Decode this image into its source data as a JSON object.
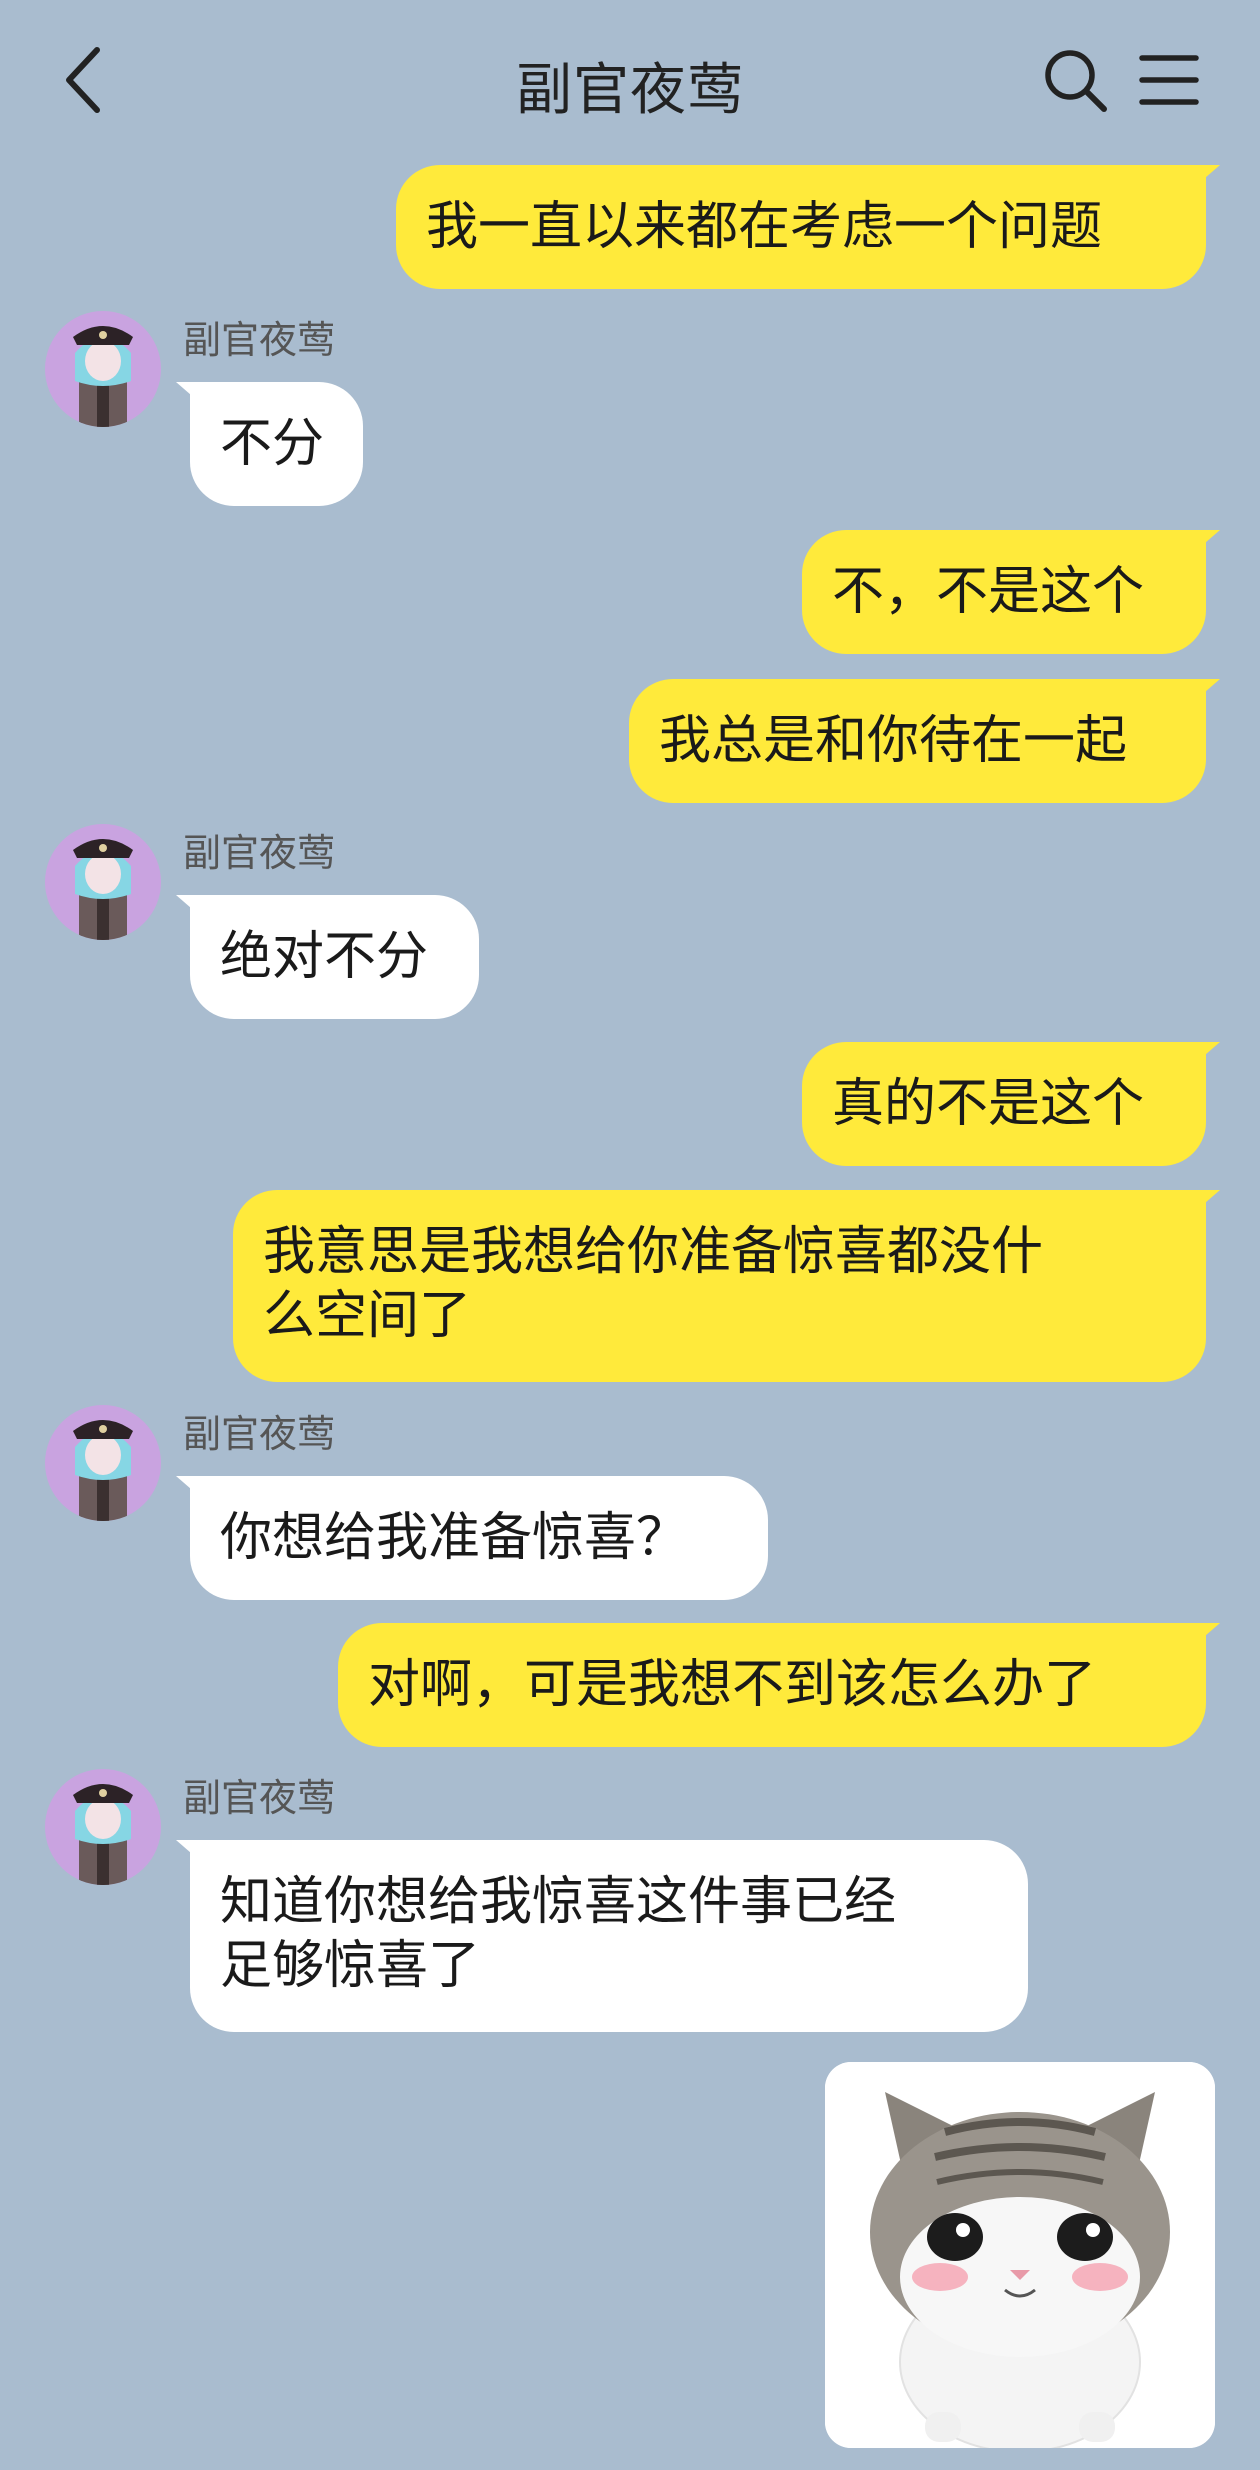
{
  "header": {
    "title": "副官夜莺",
    "back_icon": "chevron-left-icon",
    "search_icon": "search-icon",
    "menu_icon": "menu-icon"
  },
  "colors": {
    "background": "#a9bccf",
    "my_bubble": "#ffea3b",
    "their_bubble": "#ffffff",
    "avatar_bg": "#c9a3e0"
  },
  "messages": [
    {
      "from": "me",
      "text": "我一直以来都在考虑一个问题"
    },
    {
      "from": "them",
      "sender": "副官夜莺",
      "text": "不分"
    },
    {
      "from": "me",
      "text": "不，不是这个"
    },
    {
      "from": "me",
      "text": "我总是和你待在一起"
    },
    {
      "from": "them",
      "sender": "副官夜莺",
      "text": "绝对不分"
    },
    {
      "from": "me",
      "text": "真的不是这个"
    },
    {
      "from": "me",
      "text": "我意思是我想给你准备惊喜都没什\n么空间了"
    },
    {
      "from": "them",
      "sender": "副官夜莺",
      "text": "你想给我准备惊喜？"
    },
    {
      "from": "me",
      "text": "对啊，可是我想不到该怎么办了"
    },
    {
      "from": "them",
      "sender": "副官夜莺",
      "text": "知道你想给我惊喜这件事已经\n足够惊喜了"
    },
    {
      "from": "me",
      "type": "sticker",
      "icon": "cute-cat-sticker"
    }
  ]
}
